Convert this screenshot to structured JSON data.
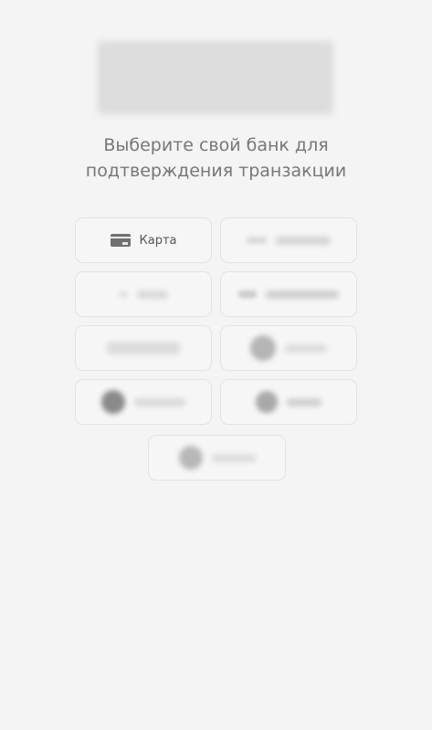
{
  "header": {
    "title": "Выберите свой банк для\nподтверждения транзакции"
  },
  "banks": [
    {
      "label": "Карта",
      "icon": "card-icon"
    }
  ],
  "colors": {
    "background": "#f4f4f4",
    "text": "#777777",
    "border": "#e3e3e3"
  }
}
